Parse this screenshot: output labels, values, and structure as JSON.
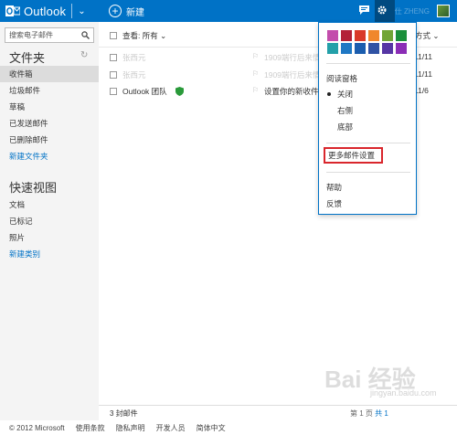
{
  "header": {
    "app_name": "Outlook",
    "new_label": "新建",
    "user_name": "仕 ZHENG"
  },
  "sidebar": {
    "search_placeholder": "搜索电子邮件",
    "folders_title": "文件夹",
    "folders": [
      {
        "label": "收件箱",
        "selected": true
      },
      {
        "label": "垃圾邮件"
      },
      {
        "label": "草稿"
      },
      {
        "label": "已发送邮件"
      },
      {
        "label": "已删除邮件"
      }
    ],
    "new_folder": "新建文件夹",
    "quick_views_title": "快速视图",
    "quick_views": [
      {
        "label": "文档"
      },
      {
        "label": "已标记"
      },
      {
        "label": "照片"
      }
    ],
    "new_category": "新建类别"
  },
  "mail": {
    "view_label": "查看: 所有 ⌄",
    "sort_label": "方式 ⌄",
    "rows": [
      {
        "sender": "张西元",
        "subject": "1909端行后来情",
        "date": "11/11"
      },
      {
        "sender": "张西元",
        "subject": "1909端行后来情",
        "date": "11/11"
      },
      {
        "sender": "Outlook 团队",
        "subject": "设置你的新收件",
        "date": "11/6"
      }
    ],
    "count": "3 封邮件",
    "pager_text": "第 1 页",
    "pager_link": "共 1",
    "accent": "#0072c6"
  },
  "settings_menu": {
    "swatches": [
      "#c34dac",
      "#b32137",
      "#d93b2b",
      "#f0872c",
      "#71a536",
      "#1b8f3a",
      "#24a0a9",
      "#1f78c4",
      "#1b5dae",
      "#2f52a4",
      "#5636a4",
      "#8b2db6"
    ],
    "reading_pane": "阅读窗格",
    "options": [
      "关闭",
      "右侧",
      "底部"
    ],
    "more_settings": "更多邮件设置",
    "help": "帮助",
    "feedback": "反馈"
  },
  "footer": {
    "items": [
      "© 2012 Microsoft",
      "使用条款",
      "隐私声明",
      "开发人员",
      "简体中文"
    ]
  },
  "watermark": {
    "main": "Bai 经验",
    "sub": "jingyan.baidu.com"
  }
}
